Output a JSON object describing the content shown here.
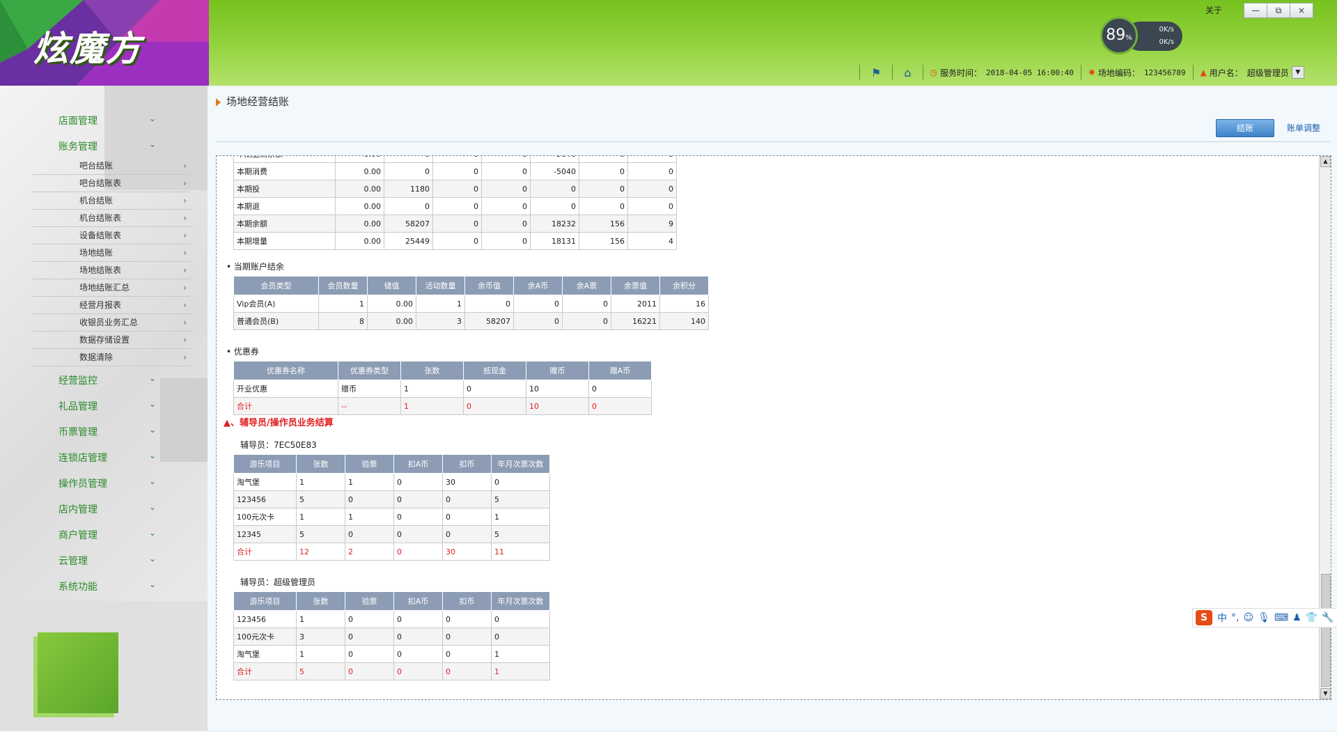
{
  "app": {
    "logo_text": "炫魔方",
    "gauge_percent": "89",
    "gauge_unit": "%",
    "up_speed": "0K/s",
    "down_speed": "0K/s",
    "about": "关于",
    "win_min": "—",
    "win_restore": "⧉",
    "win_close": "×"
  },
  "infobar": {
    "service_time_label": "服务时间：",
    "service_time": "2018-04-05 16:00:40",
    "site_code_label": "场地编码：",
    "site_code": "123456789",
    "user_label": "用户名：",
    "user_name": "超级管理员"
  },
  "sidebar": {
    "items": [
      {
        "label": "店面管理"
      },
      {
        "label": "账务管理"
      },
      {
        "label": "经营监控"
      },
      {
        "label": "礼品管理"
      },
      {
        "label": "币票管理"
      },
      {
        "label": "连锁店管理"
      },
      {
        "label": "操作员管理"
      },
      {
        "label": "店内管理"
      },
      {
        "label": "商户管理"
      },
      {
        "label": "云管理"
      },
      {
        "label": "系统功能"
      }
    ],
    "sub": [
      {
        "label": "吧台结账"
      },
      {
        "label": "吧台结账表"
      },
      {
        "label": "机台结账"
      },
      {
        "label": "机台结账表"
      },
      {
        "label": "设备结账表"
      },
      {
        "label": "场地结账"
      },
      {
        "label": "场地结账表"
      },
      {
        "label": "场地结账汇总"
      },
      {
        "label": "经营月报表"
      },
      {
        "label": "收银员业务汇总"
      },
      {
        "label": "数据存储设置"
      },
      {
        "label": "数据清除"
      }
    ]
  },
  "main": {
    "breadcrumb": "场地经营结账",
    "settle_button": "结账",
    "adjust_link": "账单调整",
    "period_table": {
      "rows": [
        [
          "本期消费",
          "0.00",
          "0",
          "0",
          "0",
          "-5040",
          "0",
          "0"
        ],
        [
          "本期投",
          "0.00",
          "1180",
          "0",
          "0",
          "0",
          "0",
          "0"
        ],
        [
          "本期退",
          "0.00",
          "0",
          "0",
          "0",
          "0",
          "0",
          "0"
        ],
        [
          "本期余额",
          "0.00",
          "58207",
          "0",
          "0",
          "18232",
          "156",
          "9"
        ],
        [
          "本期增量",
          "0.00",
          "25449",
          "0",
          "0",
          "18131",
          "156",
          "4"
        ]
      ]
    },
    "account_section": "当期账户结余",
    "account_table": {
      "headers": [
        "会员类型",
        "会员数量",
        "储值",
        "活动数量",
        "余币值",
        "余A币",
        "余A票",
        "余票值",
        "余积分"
      ],
      "rows": [
        [
          "Vip会员(A)",
          "1",
          "0.00",
          "1",
          "0",
          "0",
          "0",
          "2011",
          "16"
        ],
        [
          "普通会员(B)",
          "8",
          "0.00",
          "3",
          "58207",
          "0",
          "0",
          "16221",
          "140"
        ]
      ]
    },
    "coupon_section": "优惠券",
    "coupon_table": {
      "headers": [
        "优惠券名称",
        "优惠券类型",
        "张数",
        "抵现金",
        "赠币",
        "赠A币"
      ],
      "rows": [
        [
          "开业优惠",
          "赠币",
          "1",
          "0",
          "10",
          "0"
        ]
      ],
      "total": [
        "合计",
        "--",
        "1",
        "0",
        "10",
        "0"
      ]
    },
    "operator_section": "▲、辅导员/操作员业务结算",
    "op_headers": [
      "游乐项目",
      "张数",
      "验票",
      "扣A币",
      "扣币",
      "年月次票次数"
    ],
    "op1_label": "辅导员：7EC50E83",
    "op1_rows": [
      [
        "淘气堡",
        "1",
        "1",
        "0",
        "30",
        "0"
      ],
      [
        "123456",
        "5",
        "0",
        "0",
        "0",
        "5"
      ],
      [
        "100元次卡",
        "1",
        "1",
        "0",
        "0",
        "1"
      ],
      [
        "12345",
        "5",
        "0",
        "0",
        "0",
        "5"
      ]
    ],
    "op1_total": [
      "合计",
      "12",
      "2",
      "0",
      "30",
      "11"
    ],
    "op2_label": "辅导员：超级管理员",
    "op2_rows": [
      [
        "123456",
        "1",
        "0",
        "0",
        "0",
        "0"
      ],
      [
        "100元次卡",
        "3",
        "0",
        "0",
        "0",
        "0"
      ],
      [
        "淘气堡",
        "1",
        "0",
        "0",
        "0",
        "1"
      ]
    ],
    "op2_total": [
      "合计",
      "5",
      "0",
      "0",
      "0",
      "1"
    ]
  },
  "ime": {
    "logo": "S",
    "mode": "中",
    "punct": "°,"
  },
  "colors": {
    "accent_green": "#2a8a2a",
    "header_green": "#8fd03a",
    "table_header": "#8c9cb4",
    "total_red": "#e02020",
    "button_blue": "#3e82c9"
  }
}
